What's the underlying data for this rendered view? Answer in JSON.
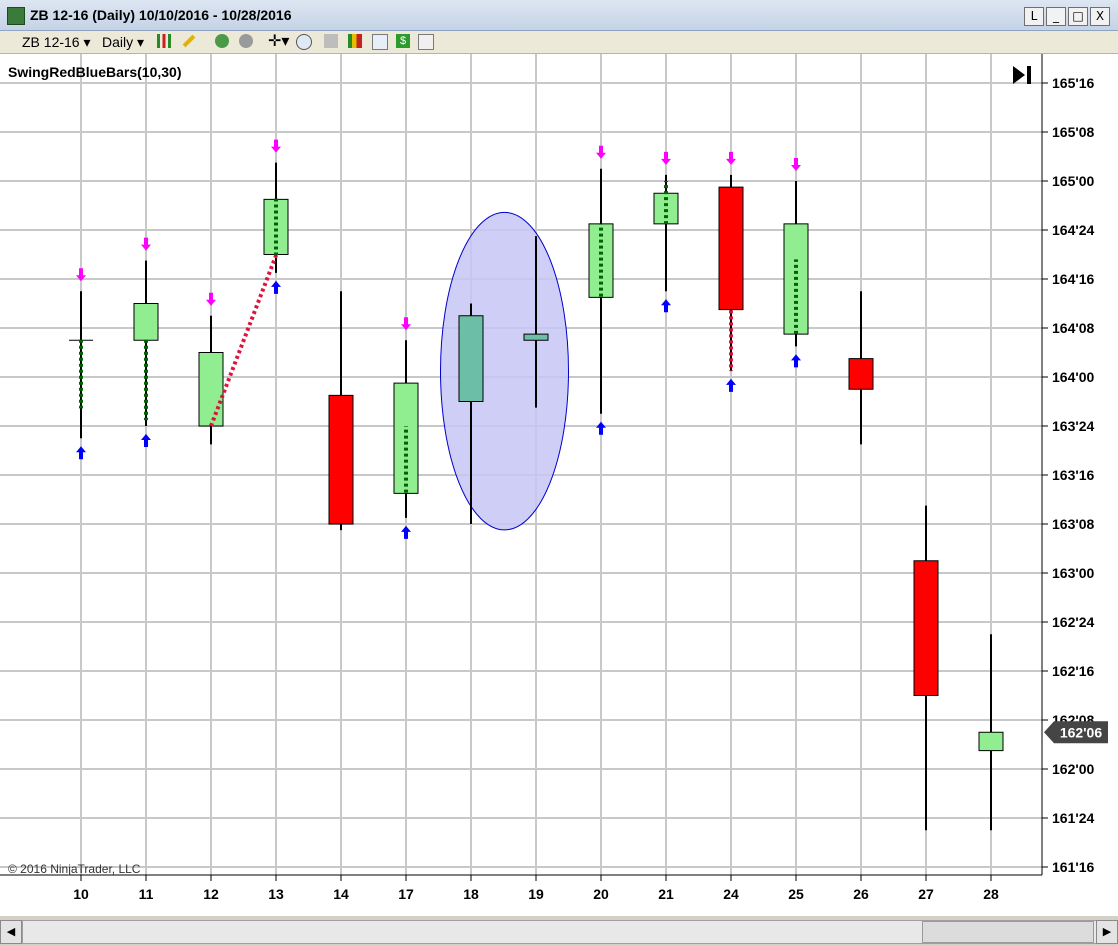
{
  "window": {
    "title": "ZB 12-16 (Daily)  10/10/2016 - 10/28/2016",
    "buttons": {
      "link": "L",
      "minimize": "_",
      "maximize": "□",
      "close": "X"
    }
  },
  "toolbar": {
    "instrument": "ZB 12-16",
    "period": "Daily",
    "icons": [
      "bar-style-icon",
      "draw-tool-icon",
      "indicator-icon",
      "strategy-icon",
      "crosshair-icon",
      "zoom-icon",
      "properties-icon",
      "chart-icon",
      "data-icon",
      "dollar-icon",
      "window-icon"
    ]
  },
  "chart": {
    "indicator_label": "SwingRedBlueBars(10,30)",
    "copyright": "© 2016 NinjaTrader, LLC",
    "current_price": "162'06",
    "colors": {
      "up": "#90ee90",
      "down": "#ff0000",
      "neutral": "#6cbfa6",
      "swing_high_arrow": "#ff00ff",
      "swing_low_arrow": "#0000ff",
      "ellipse_fill": "#c6c6f6",
      "ellipse_stroke": "#0000cc",
      "up_trend_line": "#006400",
      "down_trend_line": "#dc143c"
    }
  },
  "chart_data": {
    "type": "candlestick",
    "y_axis_ticks": [
      "165'16",
      "165'08",
      "165'00",
      "164'24",
      "164'16",
      "164'08",
      "164'00",
      "163'24",
      "163'16",
      "163'08",
      "163'00",
      "162'24",
      "162'16",
      "162'08",
      "162'00",
      "161'24",
      "161'16"
    ],
    "ylim": [
      161.5,
      165.5625
    ],
    "categories": [
      "10",
      "11",
      "12",
      "13",
      "14",
      "17",
      "18",
      "19",
      "20",
      "21",
      "24",
      "25",
      "26",
      "27",
      "28"
    ],
    "ohlc": [
      {
        "x": "10",
        "open": 164.1875,
        "high": 164.4375,
        "low": 163.6875,
        "close": 164.1875,
        "color": "doji"
      },
      {
        "x": "11",
        "open": 164.1875,
        "high": 164.5938,
        "low": 163.75,
        "close": 164.375,
        "color": "up"
      },
      {
        "x": "12",
        "open": 163.75,
        "high": 164.3125,
        "low": 163.6563,
        "close": 164.125,
        "color": "up"
      },
      {
        "x": "13",
        "open": 164.625,
        "high": 165.0938,
        "low": 164.5313,
        "close": 164.9063,
        "color": "up"
      },
      {
        "x": "14",
        "open": 163.9063,
        "high": 164.4375,
        "low": 163.2188,
        "close": 163.25,
        "color": "down"
      },
      {
        "x": "17",
        "open": 163.4063,
        "high": 164.1875,
        "low": 163.2813,
        "close": 163.9688,
        "color": "up"
      },
      {
        "x": "18",
        "open": 163.875,
        "high": 164.375,
        "low": 163.25,
        "close": 164.3125,
        "color": "neutral"
      },
      {
        "x": "19",
        "open": 164.1875,
        "high": 164.7188,
        "low": 163.8438,
        "close": 164.2188,
        "color": "neutral"
      },
      {
        "x": "20",
        "open": 164.4063,
        "high": 165.0625,
        "low": 163.8125,
        "close": 164.7813,
        "color": "up"
      },
      {
        "x": "21",
        "open": 164.7813,
        "high": 165.0313,
        "low": 164.4375,
        "close": 164.9375,
        "color": "up"
      },
      {
        "x": "24",
        "open": 164.9688,
        "high": 165.0313,
        "low": 164.0313,
        "close": 164.3438,
        "color": "down"
      },
      {
        "x": "25",
        "open": 164.2188,
        "high": 165.0,
        "low": 164.1563,
        "close": 164.7813,
        "color": "up"
      },
      {
        "x": "26",
        "open": 164.0938,
        "high": 164.4375,
        "low": 163.6563,
        "close": 163.9375,
        "color": "down"
      },
      {
        "x": "27",
        "open": 163.0625,
        "high": 163.3438,
        "low": 161.6875,
        "close": 162.375,
        "color": "down"
      },
      {
        "x": "28",
        "open": 162.0938,
        "high": 162.6875,
        "low": 161.6875,
        "close": 162.1875,
        "color": "up"
      }
    ],
    "swing_high_marks": [
      "10",
      "11",
      "12",
      "13",
      "17",
      "20",
      "21",
      "24",
      "25"
    ],
    "swing_low_marks": [
      "10",
      "11",
      "13",
      "17",
      "20",
      "21",
      "24",
      "25"
    ],
    "ellipse_range": {
      "x_from": "17.5",
      "x_to": "19.5",
      "y_high": 164.84,
      "y_low": 163.22
    }
  }
}
